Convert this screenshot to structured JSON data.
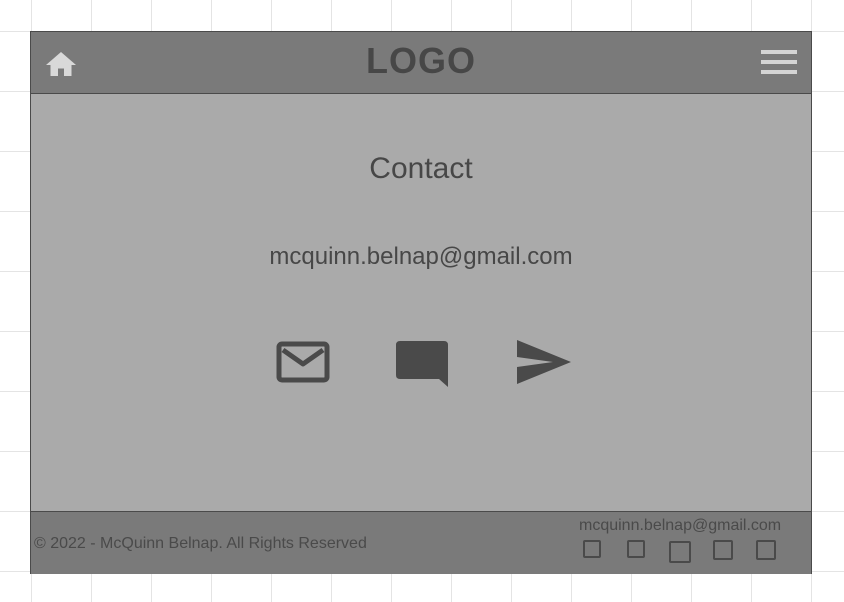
{
  "header": {
    "logo_text": "LOGO",
    "home_icon": "home-icon",
    "menu_icon": "hamburger-menu-icon"
  },
  "main": {
    "title": "Contact",
    "email": "mcquinn.belnap@gmail.com",
    "actions": [
      {
        "name": "email",
        "icon": "envelope-icon"
      },
      {
        "name": "message",
        "icon": "chat-bubble-icon"
      },
      {
        "name": "send",
        "icon": "paper-plane-icon"
      }
    ]
  },
  "footer": {
    "copyright": "© 2022 - McQuinn Belnap. All Rights Reserved",
    "email": "mcquinn.belnap@gmail.com",
    "social_links": [
      "square-icon",
      "square-icon",
      "square-icon",
      "square-icon",
      "square-icon"
    ]
  },
  "colors": {
    "page_background": "#ffffff",
    "grid_lines": "#e4e4e4",
    "frame_background": "#aaaaaa",
    "header_footer_background": "#7a7a7a",
    "text": "#474747"
  }
}
